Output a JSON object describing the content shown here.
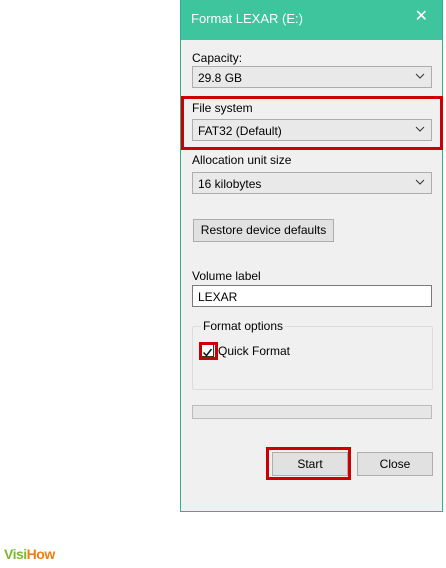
{
  "dialog": {
    "title": "Format LEXAR (E:)",
    "close_glyph": "✕",
    "capacity": {
      "label": "Capacity:",
      "value": "29.8 GB"
    },
    "file_system": {
      "label": "File system",
      "value": "FAT32 (Default)"
    },
    "allocation": {
      "label": "Allocation unit size",
      "value": "16 kilobytes"
    },
    "restore_defaults_label": "Restore device defaults",
    "volume_label": {
      "label": "Volume label",
      "value": "LEXAR"
    },
    "format_options": {
      "legend": "Format options",
      "quick_format": {
        "label": "Quick Format",
        "checked": true
      }
    },
    "progress": 0,
    "start_label": "Start",
    "close_label": "Close"
  },
  "watermark": {
    "part1": "Visi",
    "part2": "How"
  },
  "colors": {
    "titlebar": "#3ec59e",
    "highlight": "#cc0000",
    "dialog_bg": "#f0f0f0"
  },
  "icons": {
    "dropdown": "chevron-down-icon",
    "check": "checkmark-icon",
    "close": "close-icon"
  }
}
